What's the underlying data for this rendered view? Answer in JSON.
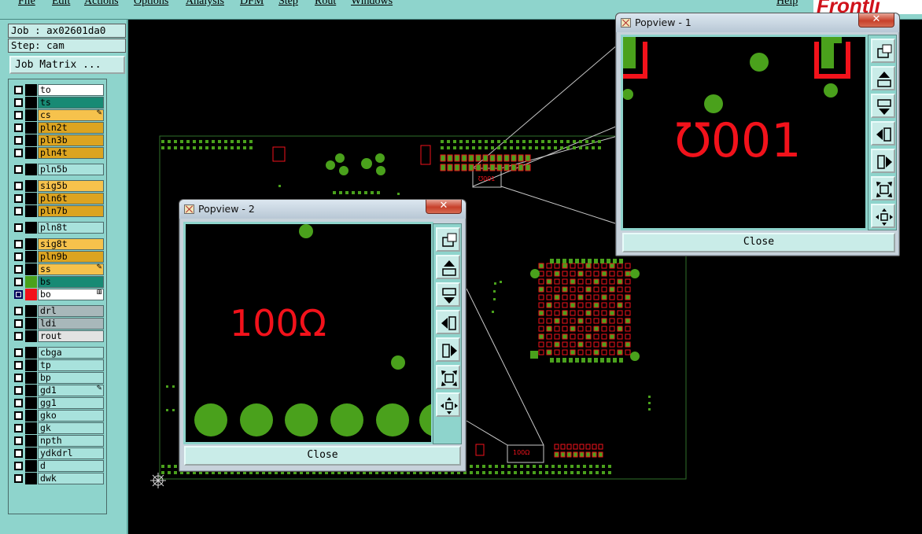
{
  "menu": {
    "items": [
      "File",
      "Edit",
      "Actions",
      "Options",
      "Analysis",
      "DFM",
      "Step",
      "Rout",
      "Windows"
    ],
    "help": "Help"
  },
  "logo": {
    "text": "Frontli"
  },
  "job_panel": {
    "job_label": "Job : ax02601da0",
    "step_label": "Step: cam",
    "matrix_button": "Job Matrix ..."
  },
  "colors": {
    "panel": "#8ed4cc",
    "pad_green": "#4aa11c",
    "trace_red": "#f2121b",
    "layer_yellow": "#dca420",
    "layer_teal": "#188a74",
    "layer_cyan": "#a8e2dc",
    "layer_gray": "#a8b8ba"
  },
  "layers": [
    {
      "name": "to",
      "bg": "#ffffff",
      "swatch": "#000000",
      "checked": false,
      "mark": ""
    },
    {
      "name": "ts",
      "bg": "#188a74",
      "swatch": "#000000",
      "checked": false,
      "mark": ""
    },
    {
      "name": "cs",
      "bg": "#f6c24c",
      "swatch": "#000000",
      "checked": false,
      "mark": "✎"
    },
    {
      "name": "pln2t",
      "bg": "#dca420",
      "swatch": "#000000",
      "checked": false,
      "mark": ""
    },
    {
      "name": "pln3b",
      "bg": "#dca420",
      "swatch": "#000000",
      "checked": false,
      "mark": ""
    },
    {
      "name": "pln4t",
      "bg": "#dca420",
      "swatch": "#000000",
      "checked": false,
      "mark": ""
    },
    {
      "name": "pln5b",
      "bg": "#a8e2dc",
      "swatch": "#000000",
      "checked": false,
      "mark": ""
    },
    {
      "name": "sig5b",
      "bg": "#f6c24c",
      "swatch": "#000000",
      "checked": false,
      "mark": ""
    },
    {
      "name": "pln6t",
      "bg": "#dca420",
      "swatch": "#000000",
      "checked": false,
      "mark": ""
    },
    {
      "name": "pln7b",
      "bg": "#dca420",
      "swatch": "#000000",
      "checked": false,
      "mark": ""
    },
    {
      "name": "pln8t",
      "bg": "#a8e2dc",
      "swatch": "#000000",
      "checked": false,
      "mark": ""
    },
    {
      "name": "sig8t",
      "bg": "#f6c24c",
      "swatch": "#000000",
      "checked": false,
      "mark": ""
    },
    {
      "name": "pln9b",
      "bg": "#dca420",
      "swatch": "#000000",
      "checked": false,
      "mark": ""
    },
    {
      "name": "ss",
      "bg": "#f6c24c",
      "swatch": "#000000",
      "checked": false,
      "mark": "✎"
    },
    {
      "name": "bs",
      "bg": "#188a74",
      "swatch": "#4aa11c",
      "checked": false,
      "mark": ""
    },
    {
      "name": "bo",
      "bg": "#ffffff",
      "swatch": "#f2121b",
      "checked": true,
      "mark": "⊞"
    },
    {
      "name": "drl",
      "bg": "#a8b8ba",
      "swatch": "#000000",
      "checked": false,
      "mark": ""
    },
    {
      "name": "ldi",
      "bg": "#a8b8ba",
      "swatch": "#000000",
      "checked": false,
      "mark": ""
    },
    {
      "name": "rout",
      "bg": "#e2e2e2",
      "swatch": "#000000",
      "checked": false,
      "mark": ""
    },
    {
      "name": "cbga",
      "bg": "#a8e2dc",
      "swatch": "#000000",
      "checked": false,
      "mark": ""
    },
    {
      "name": "tp",
      "bg": "#a8e2dc",
      "swatch": "#000000",
      "checked": false,
      "mark": ""
    },
    {
      "name": "bp",
      "bg": "#a8e2dc",
      "swatch": "#000000",
      "checked": false,
      "mark": ""
    },
    {
      "name": "gd1",
      "bg": "#a8e2dc",
      "swatch": "#000000",
      "checked": false,
      "mark": "✎"
    },
    {
      "name": "gg1",
      "bg": "#a8e2dc",
      "swatch": "#000000",
      "checked": false,
      "mark": ""
    },
    {
      "name": "gko",
      "bg": "#a8e2dc",
      "swatch": "#000000",
      "checked": false,
      "mark": ""
    },
    {
      "name": "gk",
      "bg": "#a8e2dc",
      "swatch": "#000000",
      "checked": false,
      "mark": ""
    },
    {
      "name": "npth",
      "bg": "#a8e2dc",
      "swatch": "#000000",
      "checked": false,
      "mark": ""
    },
    {
      "name": "ydkdrl",
      "bg": "#a8e2dc",
      "swatch": "#000000",
      "checked": false,
      "mark": ""
    },
    {
      "name": "d",
      "bg": "#a8e2dc",
      "swatch": "#000000",
      "checked": false,
      "mark": ""
    },
    {
      "name": "dwk",
      "bg": "#a8e2dc",
      "swatch": "#000000",
      "checked": false,
      "mark": ""
    }
  ],
  "popview1": {
    "title": "Popview - 1",
    "close_x": "✕",
    "close_button": "Close",
    "label": "℧001"
  },
  "popview2": {
    "title": "Popview - 2",
    "close_x": "✕",
    "close_button": "Close",
    "label": "100Ω"
  },
  "tools": [
    {
      "icon": "zoom-home-icon"
    },
    {
      "icon": "pan-up-icon"
    },
    {
      "icon": "pan-down-icon"
    },
    {
      "icon": "pan-left-icon"
    },
    {
      "icon": "pan-right-icon"
    },
    {
      "icon": "zoom-in-icon"
    },
    {
      "icon": "zoom-out-icon"
    }
  ]
}
